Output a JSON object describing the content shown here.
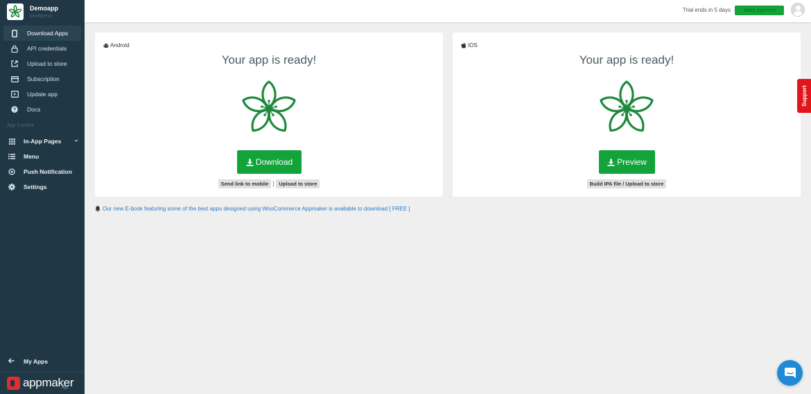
{
  "app": {
    "name": "Demoapp",
    "platform": "wordpress"
  },
  "sidebar": {
    "items": [
      {
        "label": "Download Apps",
        "icon": "phone-icon",
        "active": true
      },
      {
        "label": "API credentials",
        "icon": "lock-icon"
      },
      {
        "label": "Upload to store",
        "icon": "external-link-icon"
      },
      {
        "label": "Subscription",
        "icon": "credit-card-icon"
      },
      {
        "label": "Update app",
        "icon": "update-icon"
      },
      {
        "label": "Docs",
        "icon": "help-circle-icon"
      }
    ],
    "section_label": "App Content",
    "content_items": [
      {
        "label": "In-App Pages",
        "icon": "grid-icon",
        "has_dropdown": true
      },
      {
        "label": "Menu",
        "icon": "list-icon"
      },
      {
        "label": "Push Notification",
        "icon": "target-icon"
      },
      {
        "label": "Settings",
        "icon": "gear-icon"
      }
    ],
    "my_apps_label": "My Apps",
    "brand": {
      "word": "appmaker",
      "suffix": ".xyz"
    }
  },
  "topbar": {
    "trial_text": "Trial ends in 5 days",
    "payment_button": "Make payment"
  },
  "cards": {
    "android": {
      "platform": "Android",
      "heading": "Your app is ready!",
      "main_button": "Download",
      "link_send": "Send link to mobile",
      "link_upload": "Upload to store"
    },
    "ios": {
      "platform": "IOS",
      "heading": "Your app is ready!",
      "main_button": "Preview",
      "link_build": "Build IPA file / Upload to store"
    }
  },
  "notice": {
    "text": "Our new E-book featuring some of the best apps designed using WooCommerce Appmaker is available to download [ FREE ]"
  },
  "support_label": "Support",
  "colors": {
    "sidebar": "#203746",
    "accent_green": "#12a33a",
    "support_red": "#e3141b",
    "link_blue": "#2b7bc4",
    "chat_blue": "#1f8ad6"
  }
}
